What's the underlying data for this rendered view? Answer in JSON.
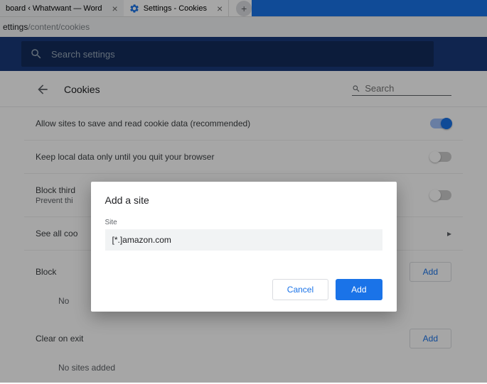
{
  "tabs": {
    "inactive": {
      "title": "board ‹ Whatvwant — Word"
    },
    "active": {
      "title": "Settings - Cookies"
    }
  },
  "url": {
    "bold": "ettings",
    "rest": "/content/cookies"
  },
  "header": {
    "search_placeholder": "Search settings"
  },
  "page": {
    "title": "Cookies",
    "search_placeholder": "Search"
  },
  "settings": {
    "allow_cookies": "Allow sites to save and read cookie data (recommended)",
    "keep_until_quit": "Keep local data only until you quit your browser",
    "block_third": "Block third",
    "prevent_third": "Prevent thi",
    "see_all": "See all coo"
  },
  "sections": {
    "block": {
      "label": "Block",
      "add": "Add",
      "no_sites": "No "
    },
    "clear": {
      "label": "Clear on exit",
      "add": "Add",
      "no_sites": "No sites added"
    }
  },
  "dialog": {
    "title": "Add a site",
    "site_label": "Site",
    "input_value": "[*.]amazon.com",
    "cancel": "Cancel",
    "add": "Add"
  }
}
